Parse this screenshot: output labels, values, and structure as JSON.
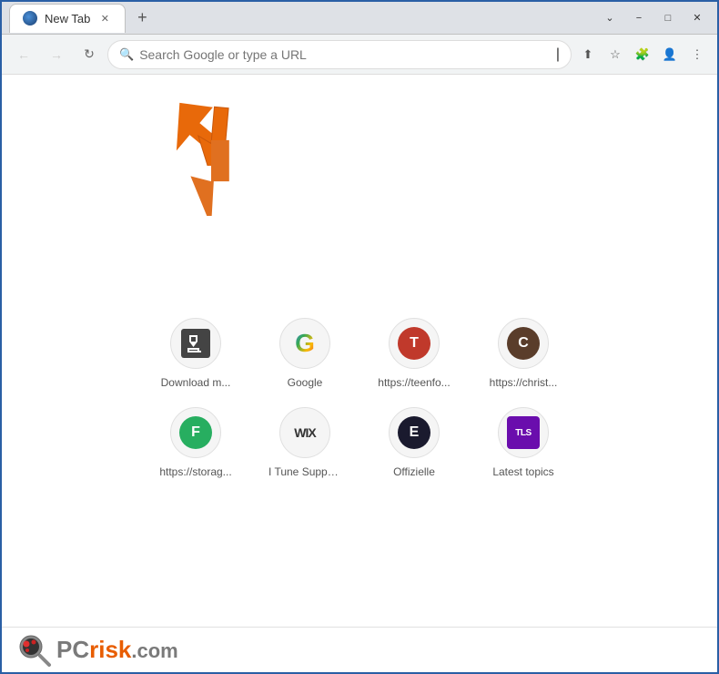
{
  "browser": {
    "tab_title": "New Tab",
    "search_placeholder": "Search Google or type a URL",
    "new_tab_label": "+"
  },
  "titlebar_controls": {
    "minimize": "−",
    "maximize": "□",
    "close": "✕",
    "chevron_down": "⌄"
  },
  "shortcuts": [
    {
      "id": "download-manager",
      "label": "Download m...",
      "icon_type": "download",
      "icon_text": "⬇"
    },
    {
      "id": "google",
      "label": "Google",
      "icon_type": "google",
      "icon_text": "G"
    },
    {
      "id": "teenfo",
      "label": "https://teenfo...",
      "icon_type": "teen",
      "icon_text": "T"
    },
    {
      "id": "christ",
      "label": "https://christ...",
      "icon_type": "christ",
      "icon_text": "C"
    },
    {
      "id": "storage",
      "label": "https://storag...",
      "icon_type": "storage",
      "icon_text": "F"
    },
    {
      "id": "itune",
      "label": "I Tune Suppo...",
      "icon_type": "wix",
      "icon_text": "WIX"
    },
    {
      "id": "offizielle",
      "label": "Offizielle",
      "icon_type": "offizielle",
      "icon_text": "E"
    },
    {
      "id": "latest-topics",
      "label": "Latest topics",
      "icon_type": "tls",
      "icon_text": "TLS"
    }
  ],
  "pcrisk": {
    "pc_text": "PC",
    "risk_text": "risk",
    "com_text": ".com"
  }
}
